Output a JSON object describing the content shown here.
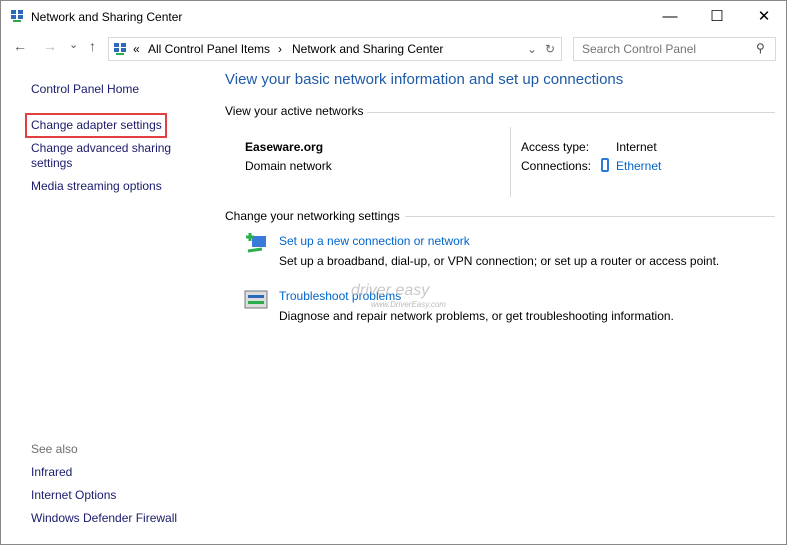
{
  "window": {
    "title": "Network and Sharing Center",
    "minimize": "—",
    "maximize": "☐",
    "close": "✕"
  },
  "nav": {
    "back": "←",
    "forward": "→",
    "recent": "⌄",
    "up": "↑",
    "overflow": "«",
    "breadcrumb": [
      "All Control Panel Items",
      "Network and Sharing Center"
    ],
    "sep": "›",
    "dropdown": "⌄",
    "refresh": "↻"
  },
  "search": {
    "placeholder": "Search Control Panel",
    "icon": "⚲"
  },
  "sidebar": {
    "items": [
      "Control Panel Home",
      "Change adapter settings",
      "Change advanced sharing settings",
      "Media streaming options"
    ],
    "see_also_label": "See also",
    "see_also": [
      "Infrared",
      "Internet Options",
      "Windows Defender Firewall"
    ]
  },
  "main": {
    "heading": "View your basic network information and set up connections",
    "active_label": "View your active networks",
    "network": {
      "name": "Easeware.org",
      "type": "Domain network",
      "access_label": "Access type:",
      "access_value": "Internet",
      "connections_label": "Connections:",
      "connections_value": "Ethernet"
    },
    "change_label": "Change your networking settings",
    "tasks": [
      {
        "title": "Set up a new connection or network",
        "desc": "Set up a broadband, dial-up, or VPN connection; or set up a router or access point."
      },
      {
        "title": "Troubleshoot problems",
        "desc": "Diagnose and repair network problems, or get troubleshooting information."
      }
    ]
  },
  "watermark": {
    "brand": "driver easy",
    "url": "www.DriverEasy.com"
  },
  "colors": {
    "link": "#0066cc",
    "heading": "#1e5aa8",
    "highlight": "#e04040"
  }
}
